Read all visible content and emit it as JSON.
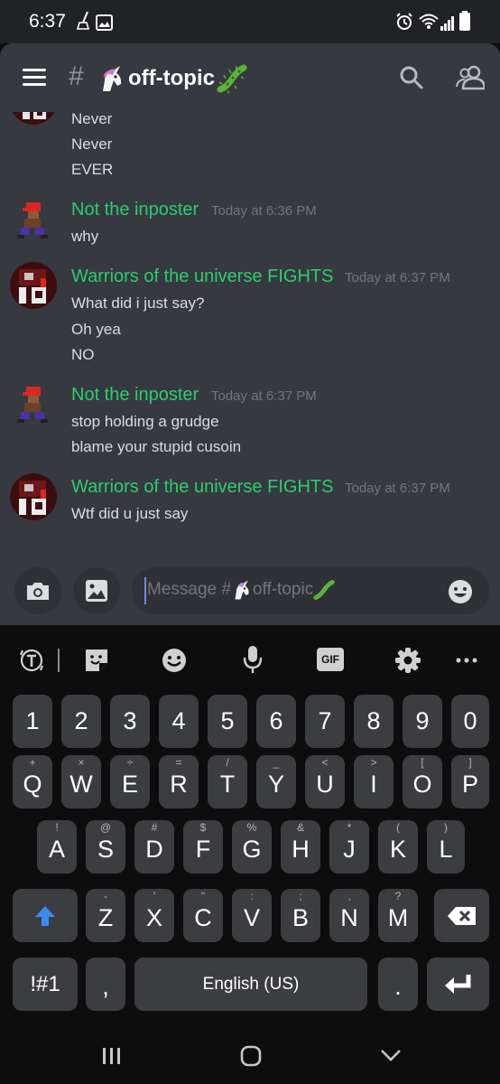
{
  "status_bar": {
    "time": "6:37"
  },
  "header": {
    "hash": "#",
    "channel_name": "off-topic"
  },
  "messages": {
    "top_lines": [
      "Never",
      "Never",
      "EVER"
    ],
    "groups": [
      {
        "author": "Not the inposter",
        "timestamp": "Today at 6:36 PM",
        "lines": [
          "why"
        ]
      },
      {
        "author": "Warriors of the universe FIGHTS",
        "timestamp": "Today at 6:37 PM",
        "lines": [
          "What did i just say?",
          "Oh yea",
          "NO"
        ]
      },
      {
        "author": "Not the inposter",
        "timestamp": "Today at 6:37 PM",
        "lines": [
          "stop holding a grudge",
          "blame your stupid cusoin"
        ]
      },
      {
        "author": "Warriors of the universe FIGHTS",
        "timestamp": "Today at 6:37 PM",
        "lines": [
          "Wtf did u just say"
        ]
      }
    ]
  },
  "composer": {
    "placeholder_prefix": "Message #",
    "placeholder_channel": "off-topic"
  },
  "keyboard": {
    "toolbar": {
      "gif_label": "GIF"
    },
    "row_numbers": [
      "1",
      "2",
      "3",
      "4",
      "5",
      "6",
      "7",
      "8",
      "9",
      "0"
    ],
    "row_qwerty": [
      {
        "k": "Q",
        "h": "+"
      },
      {
        "k": "W",
        "h": "×"
      },
      {
        "k": "E",
        "h": "÷"
      },
      {
        "k": "R",
        "h": "="
      },
      {
        "k": "T",
        "h": "/"
      },
      {
        "k": "Y",
        "h": "_"
      },
      {
        "k": "U",
        "h": "<"
      },
      {
        "k": "I",
        "h": ">"
      },
      {
        "k": "O",
        "h": "["
      },
      {
        "k": "P",
        "h": "]"
      }
    ],
    "row_asdf": [
      {
        "k": "A",
        "h": "!"
      },
      {
        "k": "S",
        "h": "@"
      },
      {
        "k": "D",
        "h": "#"
      },
      {
        "k": "F",
        "h": "$"
      },
      {
        "k": "G",
        "h": "%"
      },
      {
        "k": "H",
        "h": "&"
      },
      {
        "k": "J",
        "h": "*"
      },
      {
        "k": "K",
        "h": "("
      },
      {
        "k": "L",
        "h": ")"
      }
    ],
    "row_zxcv": [
      {
        "k": "Z",
        "h": "-"
      },
      {
        "k": "X",
        "h": "'"
      },
      {
        "k": "C",
        "h": "\""
      },
      {
        "k": "V",
        "h": ":"
      },
      {
        "k": "B",
        "h": ";"
      },
      {
        "k": "N",
        "h": ","
      },
      {
        "k": "M",
        "h": "?"
      }
    ],
    "symbols_label": "!#1",
    "comma_label": ",",
    "space_label": "English (US)",
    "period_label": "."
  },
  "colors": {
    "author": "#2ecc71",
    "accent": "#7289da",
    "chat_bg": "#36393f",
    "key_bg": "#3c3d40"
  }
}
